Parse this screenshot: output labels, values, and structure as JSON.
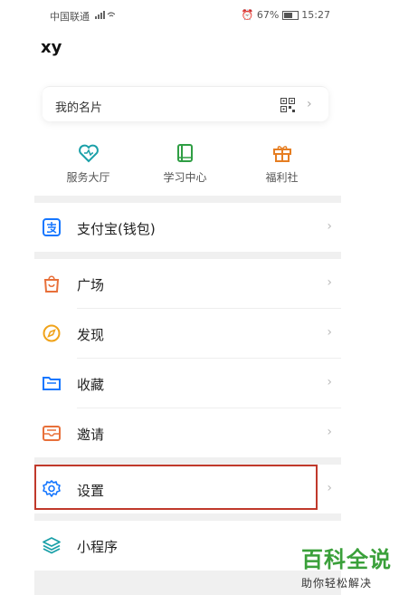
{
  "status_bar": {
    "carrier": "中国联通",
    "battery": "67%",
    "time": "15:27"
  },
  "profile": {
    "username": "xy"
  },
  "card": {
    "label": "我的名片"
  },
  "quick_links": [
    {
      "label": "服务大厅",
      "icon": "heart-icon",
      "color": "#1aa0a8"
    },
    {
      "label": "学习中心",
      "icon": "book-icon",
      "color": "#2f9e44"
    },
    {
      "label": "福利社",
      "icon": "gift-icon",
      "color": "#e67e22"
    }
  ],
  "menu": [
    {
      "label": "支付宝(钱包)",
      "icon": "alipay-icon",
      "color": "#1677ff"
    },
    {
      "label": "广场",
      "icon": "bag-icon",
      "color": "#e8703a"
    },
    {
      "label": "发现",
      "icon": "compass-icon",
      "color": "#f0a31a"
    },
    {
      "label": "收藏",
      "icon": "folder-icon",
      "color": "#1677ff"
    },
    {
      "label": "邀请",
      "icon": "envelope-icon",
      "color": "#e8703a"
    },
    {
      "label": "设置",
      "icon": "gear-icon",
      "color": "#1677ff"
    },
    {
      "label": "小程序",
      "icon": "layers-icon",
      "color": "#1aa0a8"
    }
  ],
  "watermark": {
    "title": "百科全说",
    "subtitle": "助你轻松解决"
  }
}
